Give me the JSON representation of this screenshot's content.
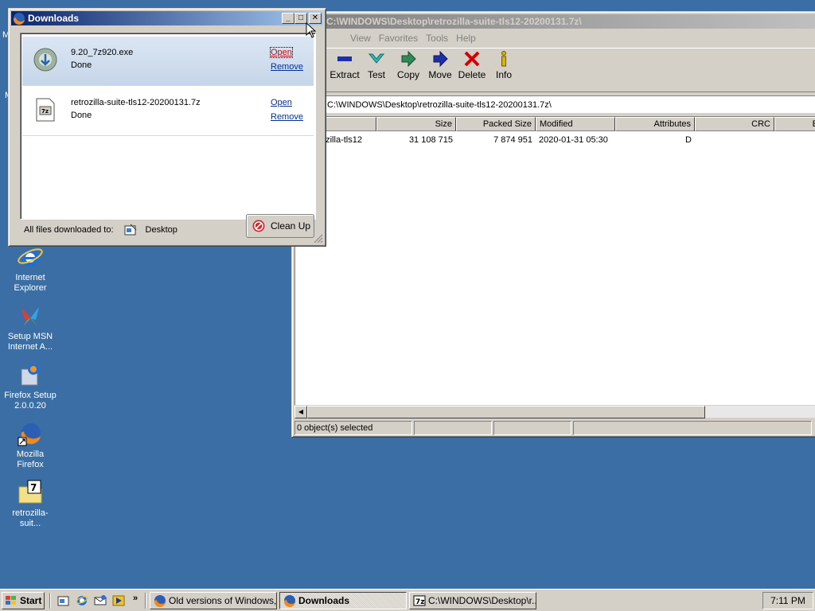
{
  "desktop": {
    "partial_labels": [
      "M",
      "M"
    ],
    "icons": [
      {
        "label": "Internet Explorer"
      },
      {
        "label": "Setup MSN Internet A..."
      },
      {
        "label": "Firefox Setup 2.0.0.20"
      },
      {
        "label": "Mozilla Firefox"
      },
      {
        "label": "retrozilla-suit..."
      }
    ]
  },
  "zip_window": {
    "title": "C:\\WINDOWS\\Desktop\\retrozilla-suite-tls12-20200131.7z\\",
    "menu": [
      "View",
      "Favorites",
      "Tools",
      "Help"
    ],
    "toolbar": [
      "Extract",
      "Test",
      "Copy",
      "Move",
      "Delete",
      "Info"
    ],
    "address": "C:\\WINDOWS\\Desktop\\retrozilla-suite-tls12-20200131.7z\\",
    "columns": [
      "Size",
      "Packed Size",
      "Modified",
      "Attributes",
      "CRC",
      "E"
    ],
    "rows": [
      {
        "name": "ozilla-tls12",
        "size": "31 108 715",
        "packed": "7 874 951",
        "modified": "2020-01-31 05:30",
        "attributes": "D",
        "crc": ""
      }
    ],
    "status": "0 object(s) selected"
  },
  "downloads_window": {
    "title": "Downloads",
    "items": [
      {
        "name": "9.20_7z920.exe",
        "status": "Done",
        "open": "Open",
        "remove": "Remove"
      },
      {
        "name": "retrozilla-suite-tls12-20200131.7z",
        "status": "Done",
        "open": "Open",
        "remove": "Remove"
      }
    ],
    "footer_label": "All files downloaded to:",
    "footer_dest": "Desktop",
    "cleanup_label": "Clean Up"
  },
  "taskbar": {
    "start_label": "Start",
    "more_glyph": "»",
    "tasks": [
      {
        "label": "Old versions of Windows, ..."
      },
      {
        "label": "Downloads"
      },
      {
        "label": "C:\\WINDOWS\\Desktop\\r..."
      }
    ],
    "clock": "7:11 PM"
  },
  "colors": {
    "desktop": "#3a6ea5",
    "active_title": "#0a246a",
    "link": "#00309c"
  }
}
